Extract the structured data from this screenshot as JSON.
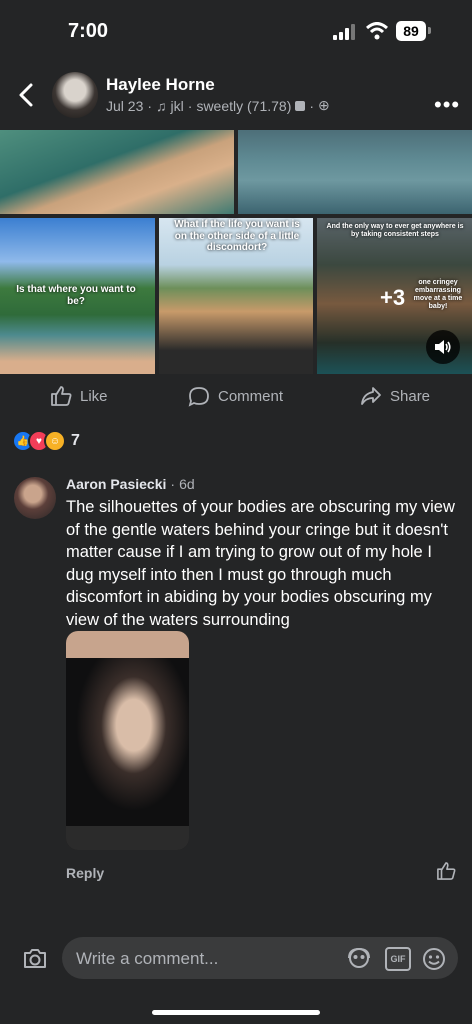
{
  "status": {
    "time": "7:00",
    "battery": "89"
  },
  "post": {
    "author": "Haylee Horne",
    "date": "Jul 23",
    "music": "jkl",
    "song": "sweetly (71.78)",
    "overlays": {
      "photo3": "Is that where you want to be?",
      "photo4": "What if the life you want is on the other side of a little discomdort?",
      "photo5": "And the only way to ever get anywhere is by taking consistent steps",
      "photo5b": "one cringey embarrassing move at a time baby!"
    },
    "more_photos": "+3",
    "actions": {
      "like": "Like",
      "comment": "Comment",
      "share": "Share"
    },
    "reaction_count": "7"
  },
  "comment": {
    "author": "Aaron Pasiecki",
    "time": "6d",
    "text": "The silhouettes of your bodies are obscuring my view of the gentle waters behind your cringe but it doesn't matter cause if I am trying to grow out of my hole I dug myself into then I must go through much discomfort in abiding by your bodies obscuring my view of  the waters surrounding",
    "reply": "Reply"
  },
  "composer": {
    "placeholder": "Write a comment...",
    "gif": "GIF"
  },
  "colors": {
    "background": "#242526",
    "accent": "#1877f2",
    "love": "#f33e58",
    "care": "#f7b125"
  }
}
